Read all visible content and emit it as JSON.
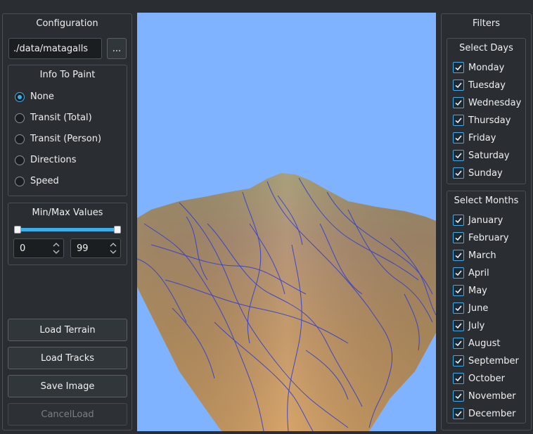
{
  "config": {
    "title": "Configuration",
    "path_value": "./data/matagalls",
    "browse_label": "...",
    "info_title": "Info To Paint",
    "radio_options": [
      "None",
      "Transit (Total)",
      "Transit (Person)",
      "Directions",
      "Speed"
    ],
    "selected_option": "None",
    "minmax_title": "Min/Max Values",
    "range_min_fraction": 0,
    "range_max_fraction": 1,
    "min_value": "0",
    "max_value": "99",
    "buttons": {
      "load_terrain": "Load Terrain",
      "load_tracks": "Load Tracks",
      "save_image": "Save Image",
      "cancel_load": "CancelLoad"
    }
  },
  "filters": {
    "title": "Filters",
    "days_title": "Select Days",
    "days": [
      "Monday",
      "Tuesday",
      "Wednesday",
      "Thursday",
      "Friday",
      "Saturday",
      "Sunday"
    ],
    "months_title": "Select Months",
    "months": [
      "January",
      "February",
      "March",
      "April",
      "May",
      "June",
      "July",
      "August",
      "September",
      "October",
      "November",
      "December"
    ]
  },
  "colors": {
    "accent": "#3daee9",
    "sky": "#80b3ff",
    "tracks": "#2f3fcf"
  }
}
